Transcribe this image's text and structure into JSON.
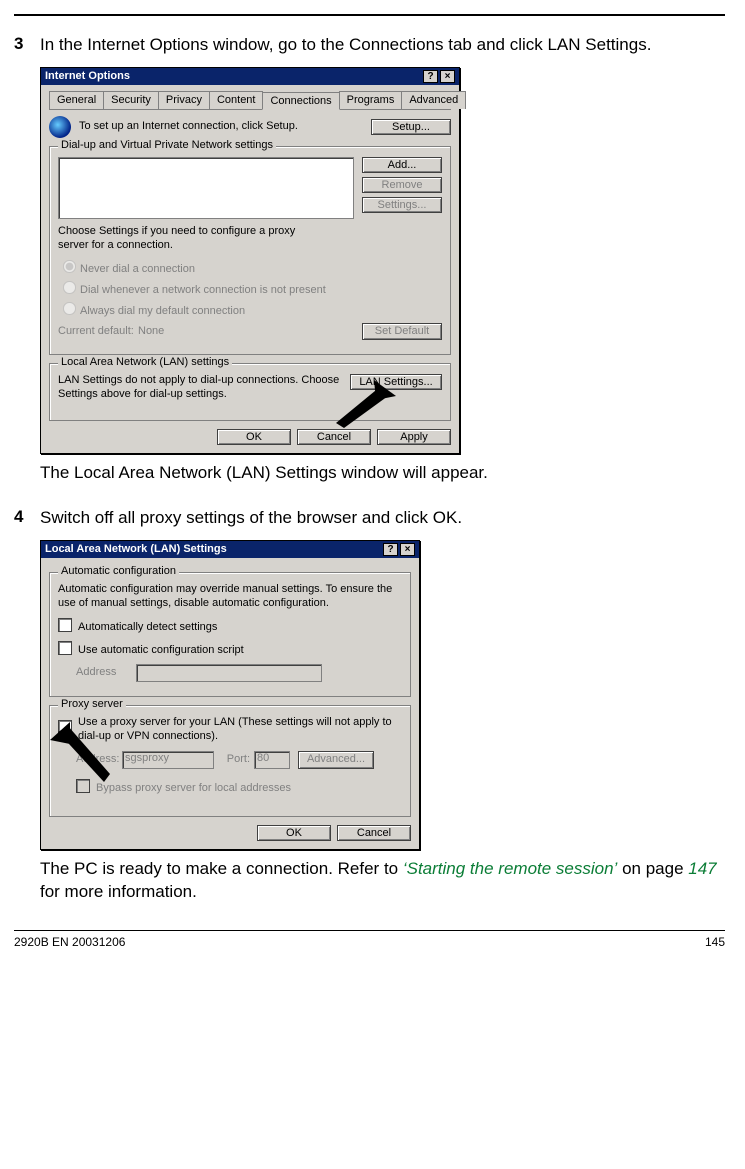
{
  "document": {
    "footer_left": "2920B EN 20031206",
    "footer_right": "145"
  },
  "step3": {
    "num": "3",
    "text": "In the Internet Options window, go to the Connections tab and click LAN Settings.",
    "caption": "The Local Area Network (LAN) Settings window will appear."
  },
  "step4": {
    "num": "4",
    "text": "Switch off all proxy settings of the browser and click OK.",
    "caption_before": "The PC is ready to make a connection. Refer to ",
    "ref_text": "‘Starting the remote session’",
    "caption_mid": " on page ",
    "ref_page": "147",
    "caption_after": " for more information."
  },
  "dialog1": {
    "title": "Internet Options",
    "help_btn": "?",
    "close_btn": "×",
    "tabs": [
      "General",
      "Security",
      "Privacy",
      "Content",
      "Connections",
      "Programs",
      "Advanced"
    ],
    "active_tab": "Connections",
    "setup_text": "To set up an Internet connection, click Setup.",
    "setup_btn": "Setup...",
    "group1_title": "Dial-up and Virtual Private Network settings",
    "add_btn": "Add...",
    "remove_btn": "Remove",
    "settings_btn": "Settings...",
    "choose_text": "Choose Settings if you need to configure a proxy server for a connection.",
    "radio1": "Never dial a connection",
    "radio2": "Dial whenever a network connection is not present",
    "radio3": "Always dial my default connection",
    "current_default_label": "Current default:",
    "current_default_value": "None",
    "set_default_btn": "Set Default",
    "group2_title": "Local Area Network (LAN) settings",
    "lan_text": "LAN Settings do not apply to dial-up connections. Choose Settings above for dial-up settings.",
    "lan_btn": "LAN Settings...",
    "ok": "OK",
    "cancel": "Cancel",
    "apply": "Apply"
  },
  "dialog2": {
    "title": "Local Area Network (LAN) Settings",
    "help_btn": "?",
    "close_btn": "×",
    "group1_title": "Automatic configuration",
    "auto_text": "Automatic configuration may override manual settings.  To ensure the use of manual settings, disable automatic configuration.",
    "chk1": "Automatically detect settings",
    "chk2": "Use automatic configuration script",
    "address_label": "Address",
    "group2_title": "Proxy server",
    "proxy_text": "Use a proxy server for your LAN (These settings will not apply to dial-up or VPN connections).",
    "addr_label": "Address:",
    "addr_value": "sgsproxy",
    "port_label": "Port:",
    "port_value": "80",
    "advanced_btn": "Advanced...",
    "bypass": "Bypass proxy server for local addresses",
    "ok": "OK",
    "cancel": "Cancel"
  }
}
